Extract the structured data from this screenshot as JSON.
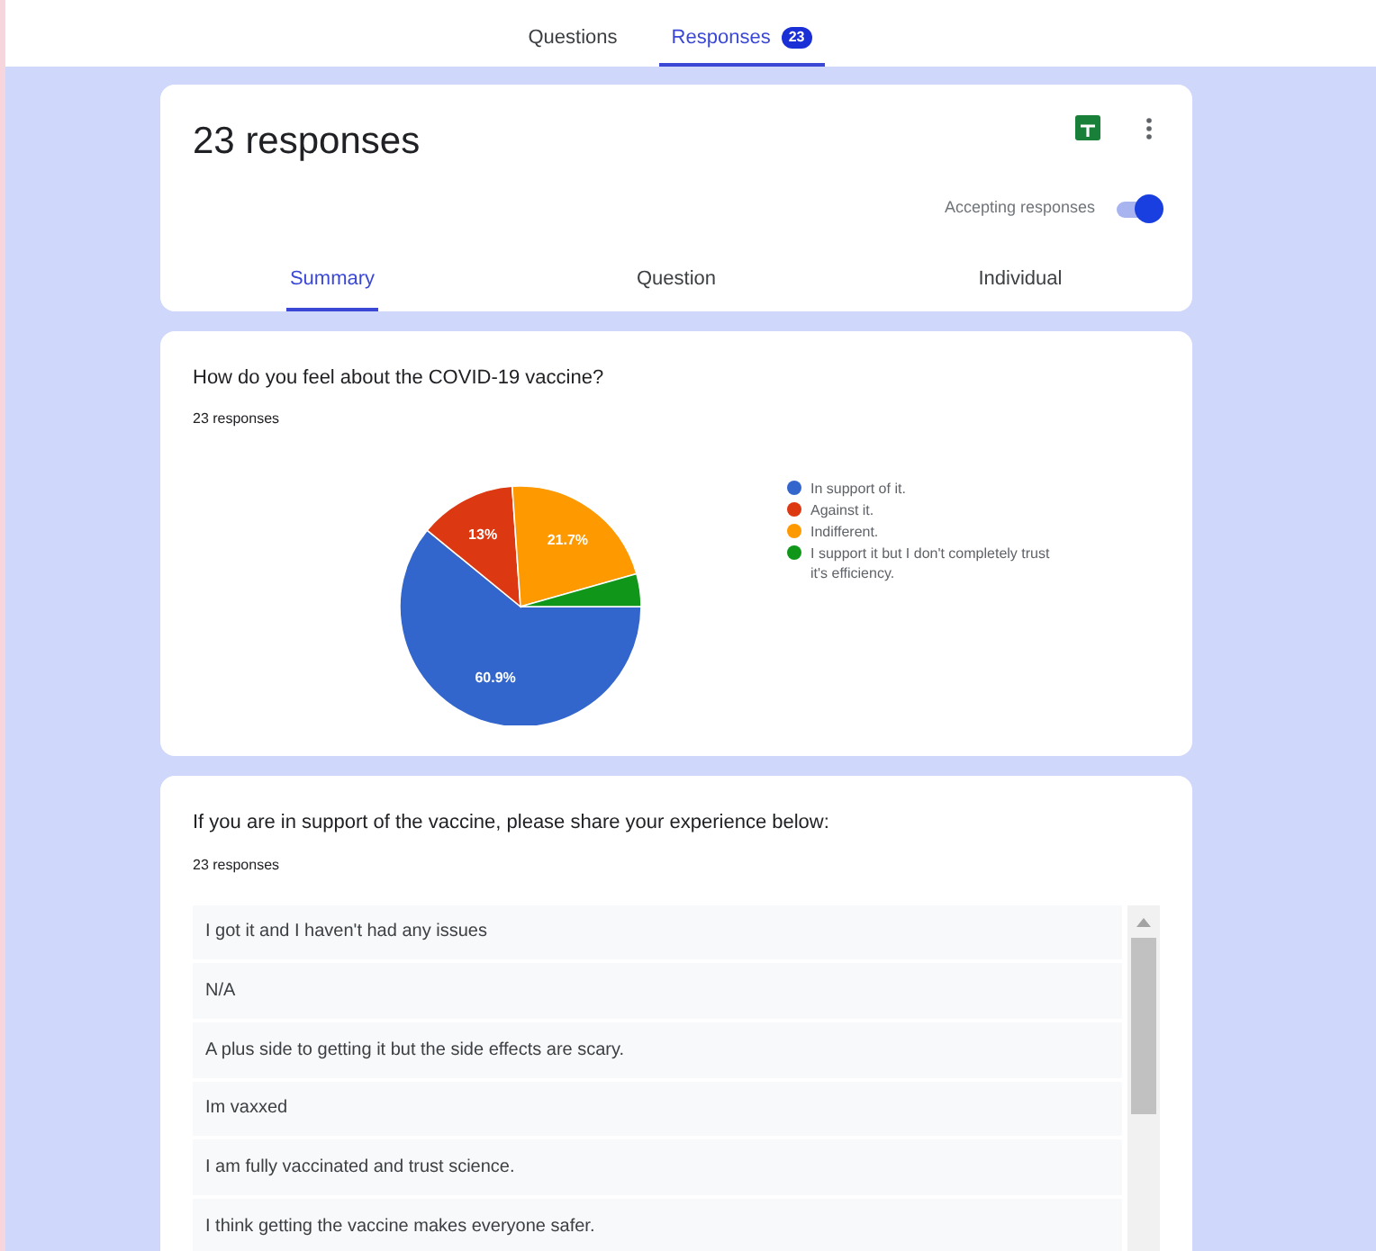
{
  "top_tabs": [
    {
      "label": "Questions",
      "selected": false
    },
    {
      "label": "Responses",
      "selected": true,
      "badge": "23"
    }
  ],
  "summary_card": {
    "title": "23 responses",
    "accepting_label": "Accepting responses",
    "accepting": true,
    "tabs": [
      {
        "label": "Summary",
        "selected": true
      },
      {
        "label": "Question",
        "selected": false
      },
      {
        "label": "Individual",
        "selected": false
      }
    ]
  },
  "question_1": {
    "title": "How do you feel about the COVID-19 vaccine?",
    "count": "23 responses",
    "chart_data": {
      "type": "pie",
      "categories": [
        "In support of it.",
        "Against it.",
        "Indifferent.",
        "I support it but I don't completely trust it's efficiency."
      ],
      "legend": "right",
      "series": [
        {
          "colors": [
            "#3366cc",
            "#dc3912",
            "#ff9900",
            "#109618"
          ],
          "values": [
            60.9,
            13,
            21.7,
            4.4
          ]
        }
      ],
      "value_labels": [
        "60.9%",
        "13%",
        "21.7%",
        null
      ]
    }
  },
  "question_2": {
    "title": "If you are in support of the vaccine, please share your experience below:",
    "count": "23 responses",
    "answers": [
      "I got it and I haven't had any issues",
      "N/A",
      "A plus side to getting it but the side effects are scary.",
      "Im vaxxed",
      "I am fully vaccinated and trust science.",
      "I think getting the vaccine makes everyone safer."
    ]
  }
}
